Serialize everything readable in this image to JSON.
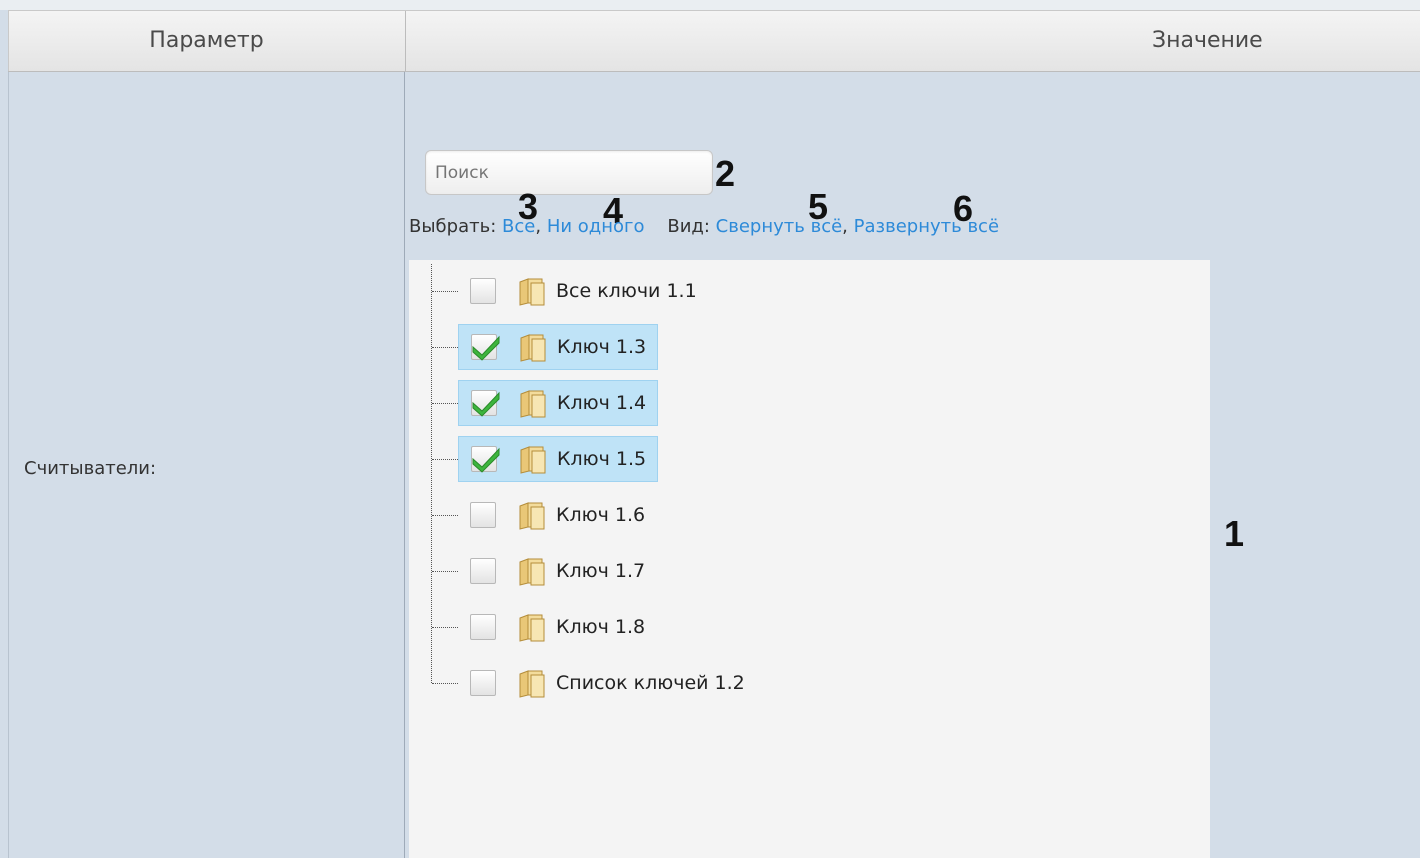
{
  "header": {
    "param_col": "Параметр",
    "value_col": "Значение"
  },
  "row": {
    "label": "Считыватели:"
  },
  "search": {
    "placeholder": "Поиск"
  },
  "select_links": {
    "label": "Выбрать:",
    "all": "Все",
    "none": "Ни одного",
    "view_label": "Вид:",
    "collapse_all": "Свернуть всё",
    "expand_all": "Развернуть всё",
    "comma": ","
  },
  "callouts": {
    "c1": "1",
    "c2": "2",
    "c3": "3",
    "c4": "4",
    "c5": "5",
    "c6": "6"
  },
  "tree": {
    "items": [
      {
        "label": "Все ключи 1.1",
        "checked": false,
        "icon": "folder-icon"
      },
      {
        "label": "Ключ 1.3",
        "checked": true,
        "icon": "folder-icon"
      },
      {
        "label": "Ключ 1.4",
        "checked": true,
        "icon": "folder-icon"
      },
      {
        "label": "Ключ 1.5",
        "checked": true,
        "icon": "folder-icon"
      },
      {
        "label": "Ключ 1.6",
        "checked": false,
        "icon": "folder-icon"
      },
      {
        "label": "Ключ 1.7",
        "checked": false,
        "icon": "folder-icon"
      },
      {
        "label": "Ключ 1.8",
        "checked": false,
        "icon": "folder-icon"
      },
      {
        "label": "Список ключей 1.2",
        "checked": false,
        "icon": "folder-icon"
      }
    ]
  },
  "colors": {
    "link": "#2d8ad8",
    "selected_bg": "#bfe3f7",
    "check_green": "#3db53d",
    "panel_bg": "#d3dde8"
  }
}
